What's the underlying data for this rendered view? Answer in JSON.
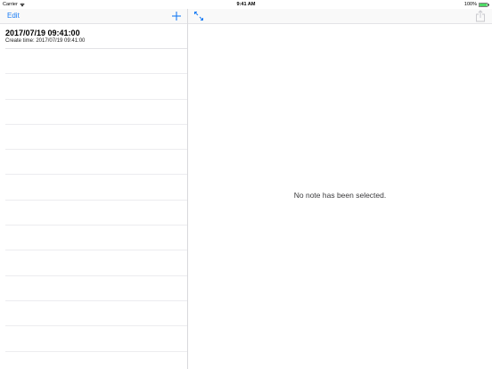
{
  "status_bar": {
    "carrier": "Carrier",
    "time": "9:41 AM",
    "battery": "100%"
  },
  "master_nav": {
    "edit_label": "Edit",
    "add_icon": "plus-icon"
  },
  "detail_nav": {
    "expand_icon": "expand-arrows-icon",
    "share_icon": "share-icon"
  },
  "notes": [
    {
      "title": "2017/07/19 09:41:00",
      "subtitle": "Create time: 2017/07/19 09:41:00"
    }
  ],
  "detail": {
    "empty_message": "No note has been selected."
  },
  "colors": {
    "accent": "#1a7cf4",
    "battery": "#4cd964",
    "separator": "#e3e3e6"
  }
}
